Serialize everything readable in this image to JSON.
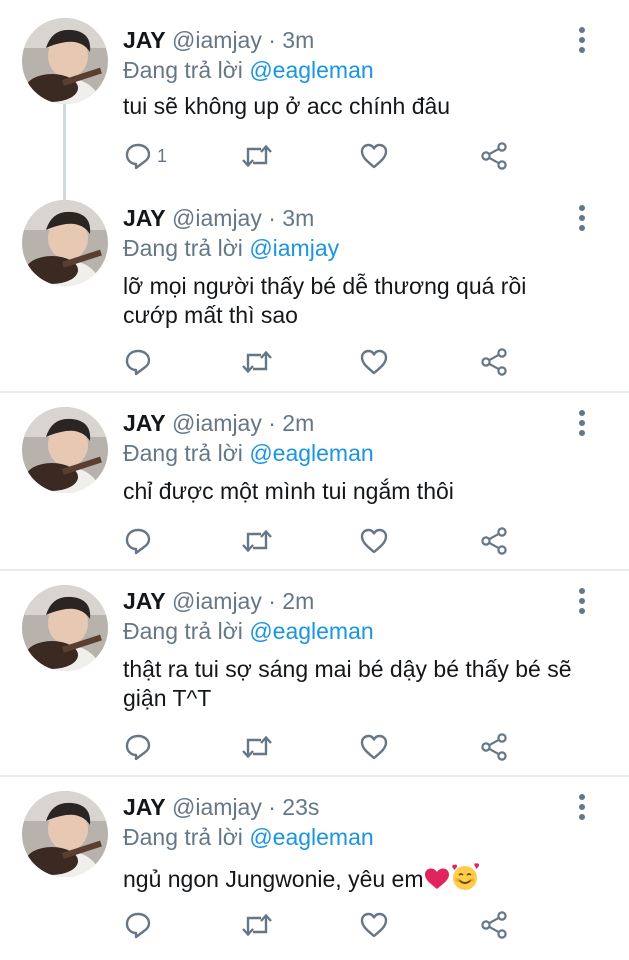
{
  "reply_prefix": "Đang trả lời",
  "dot": "·",
  "colors": {
    "link": "#1b95e0",
    "muted": "#657786",
    "text": "#14171a",
    "divider": "#e6ecf0",
    "heart_emoji": "#e0245e"
  },
  "icons": [
    "reply-icon",
    "retweet-icon",
    "like-icon",
    "share-icon",
    "more-options-icon"
  ],
  "tweets": [
    {
      "name": "JAY",
      "handle": "@iamjay",
      "time": "3m",
      "reply_to": "@eagleman",
      "text": "tui sẽ không up ở acc chính đâu",
      "reply_count": "1"
    },
    {
      "name": "JAY",
      "handle": "@iamjay",
      "time": "3m",
      "reply_to": "@iamjay",
      "text": "lỡ mọi người thấy bé dễ thương quá rồi cướp mất thì sao",
      "reply_count": ""
    },
    {
      "name": "JAY",
      "handle": "@iamjay",
      "time": "2m",
      "reply_to": "@eagleman",
      "text": "chỉ được một mình tui ngắm thôi",
      "reply_count": ""
    },
    {
      "name": "JAY",
      "handle": "@iamjay",
      "time": "2m",
      "reply_to": "@eagleman",
      "text": "thật ra tui sợ sáng mai bé dậy bé thấy bé sẽ giận T^T",
      "reply_count": ""
    },
    {
      "name": "JAY",
      "handle": "@iamjay",
      "time": "23s",
      "reply_to": "@eagleman",
      "text": "ngủ ngon Jungwonie, yêu em",
      "reply_count": "",
      "emojis": [
        "red-heart-emoji",
        "smiling-face-with-hearts-emoji"
      ]
    }
  ]
}
